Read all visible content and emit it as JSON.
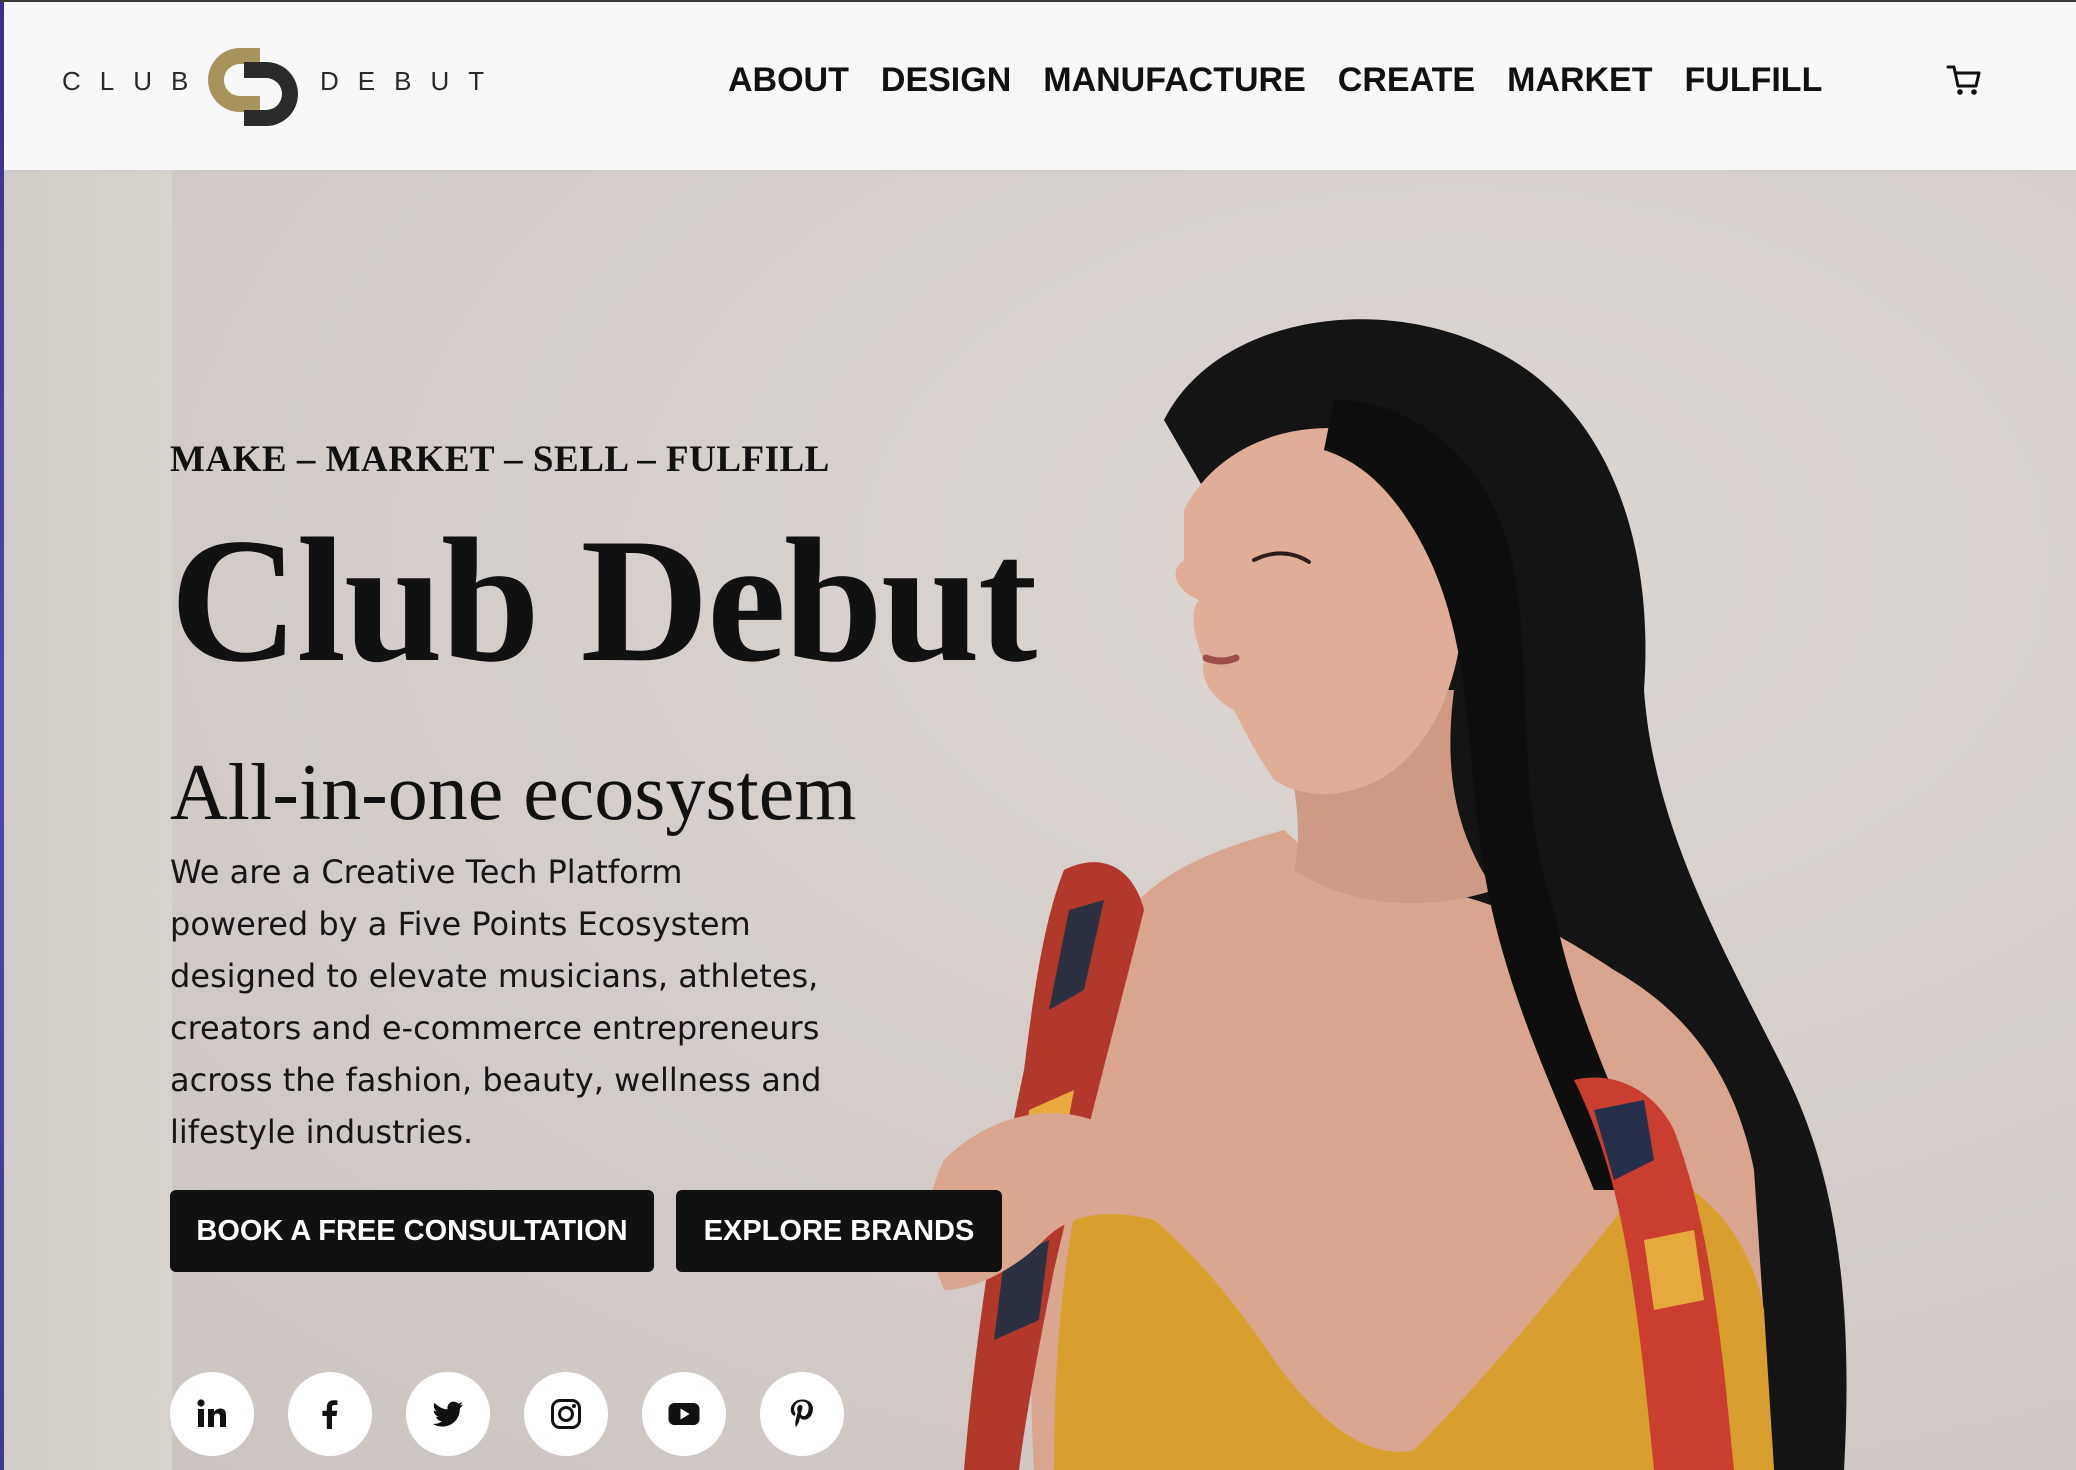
{
  "brand": {
    "logo_left": "CLUB",
    "logo_right": "DEBUT",
    "gold": "#a8955e",
    "dark": "#2b2b2b"
  },
  "nav": {
    "items": [
      {
        "label": "ABOUT"
      },
      {
        "label": "DESIGN"
      },
      {
        "label": "MANUFACTURE"
      },
      {
        "label": "CREATE"
      },
      {
        "label": "MARKET"
      },
      {
        "label": "FULFILL"
      }
    ],
    "cart_icon": "cart-icon"
  },
  "hero": {
    "tagline": "MAKE – MARKET – SELL – FULFILL",
    "title": "Club Debut",
    "subtitle": "All-in-one ecosystem",
    "description_lines": [
      "We are a Creative Tech Platform",
      "powered by a Five Points Ecosystem",
      "designed to elevate musicians, athletes,",
      "creators and e-commerce entrepreneurs",
      "across the fashion, beauty, wellness and",
      "lifestyle industries."
    ],
    "primary_button": "BOOK A FREE CONSULTATION",
    "secondary_button": "EXPLORE BRANDS",
    "background": "#d7d1ce"
  },
  "socials": [
    {
      "icon": "linkedin-icon"
    },
    {
      "icon": "facebook-icon"
    },
    {
      "icon": "twitter-icon"
    },
    {
      "icon": "instagram-icon"
    },
    {
      "icon": "youtube-icon"
    },
    {
      "icon": "pinterest-icon"
    }
  ]
}
